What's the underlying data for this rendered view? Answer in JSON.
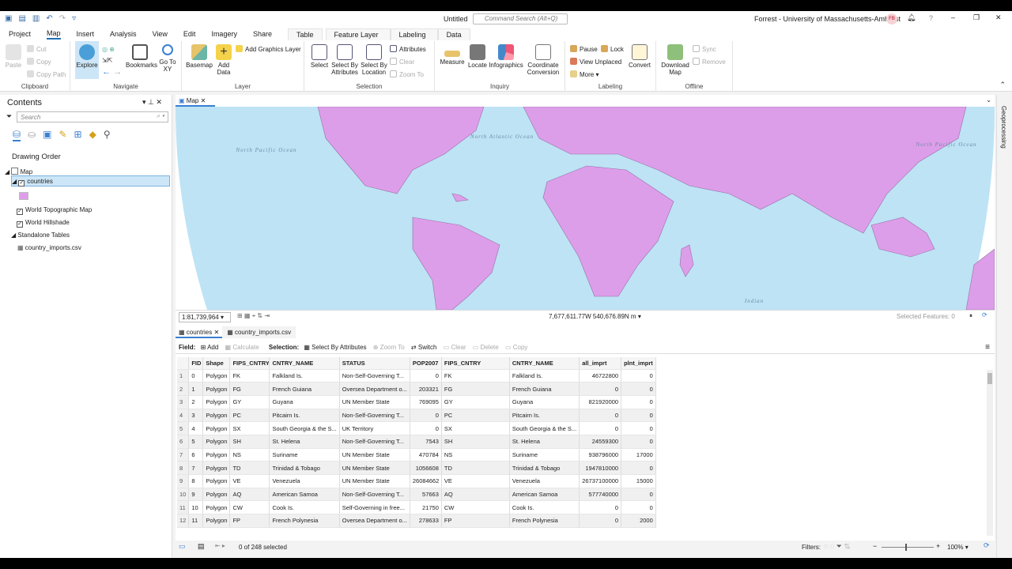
{
  "titlebar": {
    "doc": "Untitled",
    "search_placeholder": "Command Search (Alt+Q)",
    "user": "Forrest - University of Massachusetts-Amherst",
    "initials": "FB"
  },
  "tabs": [
    "Project",
    "Map",
    "Insert",
    "Analysis",
    "View",
    "Edit",
    "Imagery",
    "Share",
    "Table",
    "Feature Layer",
    "Labeling",
    "Data"
  ],
  "ribbon": {
    "clipboard": {
      "label": "Clipboard",
      "paste": "Paste",
      "cut": "Cut",
      "copy": "Copy",
      "copy_path": "Copy Path"
    },
    "navigate": {
      "label": "Navigate",
      "explore": "Explore",
      "bookmarks": "Bookmarks",
      "goto": "Go To XY"
    },
    "layer": {
      "label": "Layer",
      "basemap": "Basemap",
      "add_data": "Add Data",
      "add_graphics": "Add Graphics Layer"
    },
    "selection": {
      "label": "Selection",
      "select": "Select",
      "by_attr": "Select By Attributes",
      "by_loc": "Select By Location",
      "attributes": "Attributes",
      "clear": "Clear",
      "zoom_to": "Zoom To"
    },
    "inquiry": {
      "label": "Inquiry",
      "measure": "Measure",
      "locate": "Locate",
      "infographics": "Infographics",
      "coord": "Coordinate Conversion"
    },
    "labeling": {
      "label": "Labeling",
      "pause": "Pause",
      "lock": "Lock",
      "view_unplaced": "View Unplaced",
      "more": "More",
      "convert": "Convert"
    },
    "offline": {
      "label": "Offline",
      "download": "Download Map",
      "sync": "Sync",
      "remove": "Remove"
    }
  },
  "contents": {
    "title": "Contents",
    "search_placeholder": "Search",
    "drawing_order": "Drawing Order",
    "items": [
      "Map",
      "countries",
      "World Topographic Map",
      "World Hillshade",
      "Standalone Tables",
      "country_imports.csv"
    ]
  },
  "map": {
    "tab": "Map",
    "scale": "1:81,739,964",
    "coords": "7,677,611.77W 540,676.89N m",
    "selected": "Selected Features: 0",
    "labels": [
      "North Pacific Ocean",
      "North Atlantic Ocean",
      "North Pacific Ocean",
      "Indian"
    ]
  },
  "table": {
    "tabs": [
      "countries",
      "country_imports.csv"
    ],
    "toolbar": {
      "field": "Field:",
      "add": "Add",
      "calculate": "Calculate",
      "selection": "Selection:",
      "select_by_attr": "Select By Attributes",
      "zoom_to": "Zoom To",
      "switch": "Switch",
      "clear": "Clear",
      "delete": "Delete",
      "copy": "Copy"
    },
    "columns": [
      "FID",
      "Shape",
      "FIPS_CNTRY",
      "CNTRY_NAME",
      "STATUS",
      "POP2007",
      "FIPS_CNTRY",
      "CNTRY_NAME",
      "all_imprt",
      "plnt_imprt"
    ],
    "rows": [
      [
        "0",
        "Polygon",
        "FK",
        "Falkland Is.",
        "Non-Self-Governing T...",
        "0",
        "FK",
        "Falkland Is.",
        "46722800",
        "0"
      ],
      [
        "1",
        "Polygon",
        "FG",
        "French Guiana",
        "Oversea Department o...",
        "203321",
        "FG",
        "French Guiana",
        "0",
        "0"
      ],
      [
        "2",
        "Polygon",
        "GY",
        "Guyana",
        "UN Member State",
        "769095",
        "GY",
        "Guyana",
        "821920000",
        "0"
      ],
      [
        "3",
        "Polygon",
        "PC",
        "Pitcairn Is.",
        "Non-Self-Governing T...",
        "0",
        "PC",
        "Pitcairn Is.",
        "0",
        "0"
      ],
      [
        "4",
        "Polygon",
        "SX",
        "South Georgia & the S...",
        "UK Territory",
        "0",
        "SX",
        "South Georgia & the S...",
        "0",
        "0"
      ],
      [
        "5",
        "Polygon",
        "SH",
        "St. Helena",
        "Non-Self-Governing T...",
        "7543",
        "SH",
        "St. Helena",
        "24559300",
        "0"
      ],
      [
        "6",
        "Polygon",
        "NS",
        "Suriname",
        "UN Member State",
        "470784",
        "NS",
        "Suriname",
        "938796000",
        "17000"
      ],
      [
        "7",
        "Polygon",
        "TD",
        "Trinidad & Tobago",
        "UN Member State",
        "1056608",
        "TD",
        "Trinidad & Tobago",
        "1947810000",
        "0"
      ],
      [
        "8",
        "Polygon",
        "VE",
        "Venezuela",
        "UN Member State",
        "26084662",
        "VE",
        "Venezuela",
        "26737100000",
        "15000"
      ],
      [
        "9",
        "Polygon",
        "AQ",
        "American Samoa",
        "Non-Self-Governing T...",
        "57663",
        "AQ",
        "American Samoa",
        "577740000",
        "0"
      ],
      [
        "10",
        "Polygon",
        "CW",
        "Cook Is.",
        "Self-Governing in free...",
        "21750",
        "CW",
        "Cook Is.",
        "0",
        "0"
      ],
      [
        "11",
        "Polygon",
        "FP",
        "French Polynesia",
        "Oversea Department o...",
        "278633",
        "FP",
        "French Polynesia",
        "0",
        "2000"
      ]
    ],
    "selected_count": "0 of 248 selected",
    "filters": "Filters:",
    "zoom": "100%"
  },
  "side": {
    "geoprocessing": "Geoprocessing"
  },
  "colors": {
    "land": "#dd9ee9",
    "ocean": "#bde3f5",
    "accent": "#1f6fb5"
  }
}
